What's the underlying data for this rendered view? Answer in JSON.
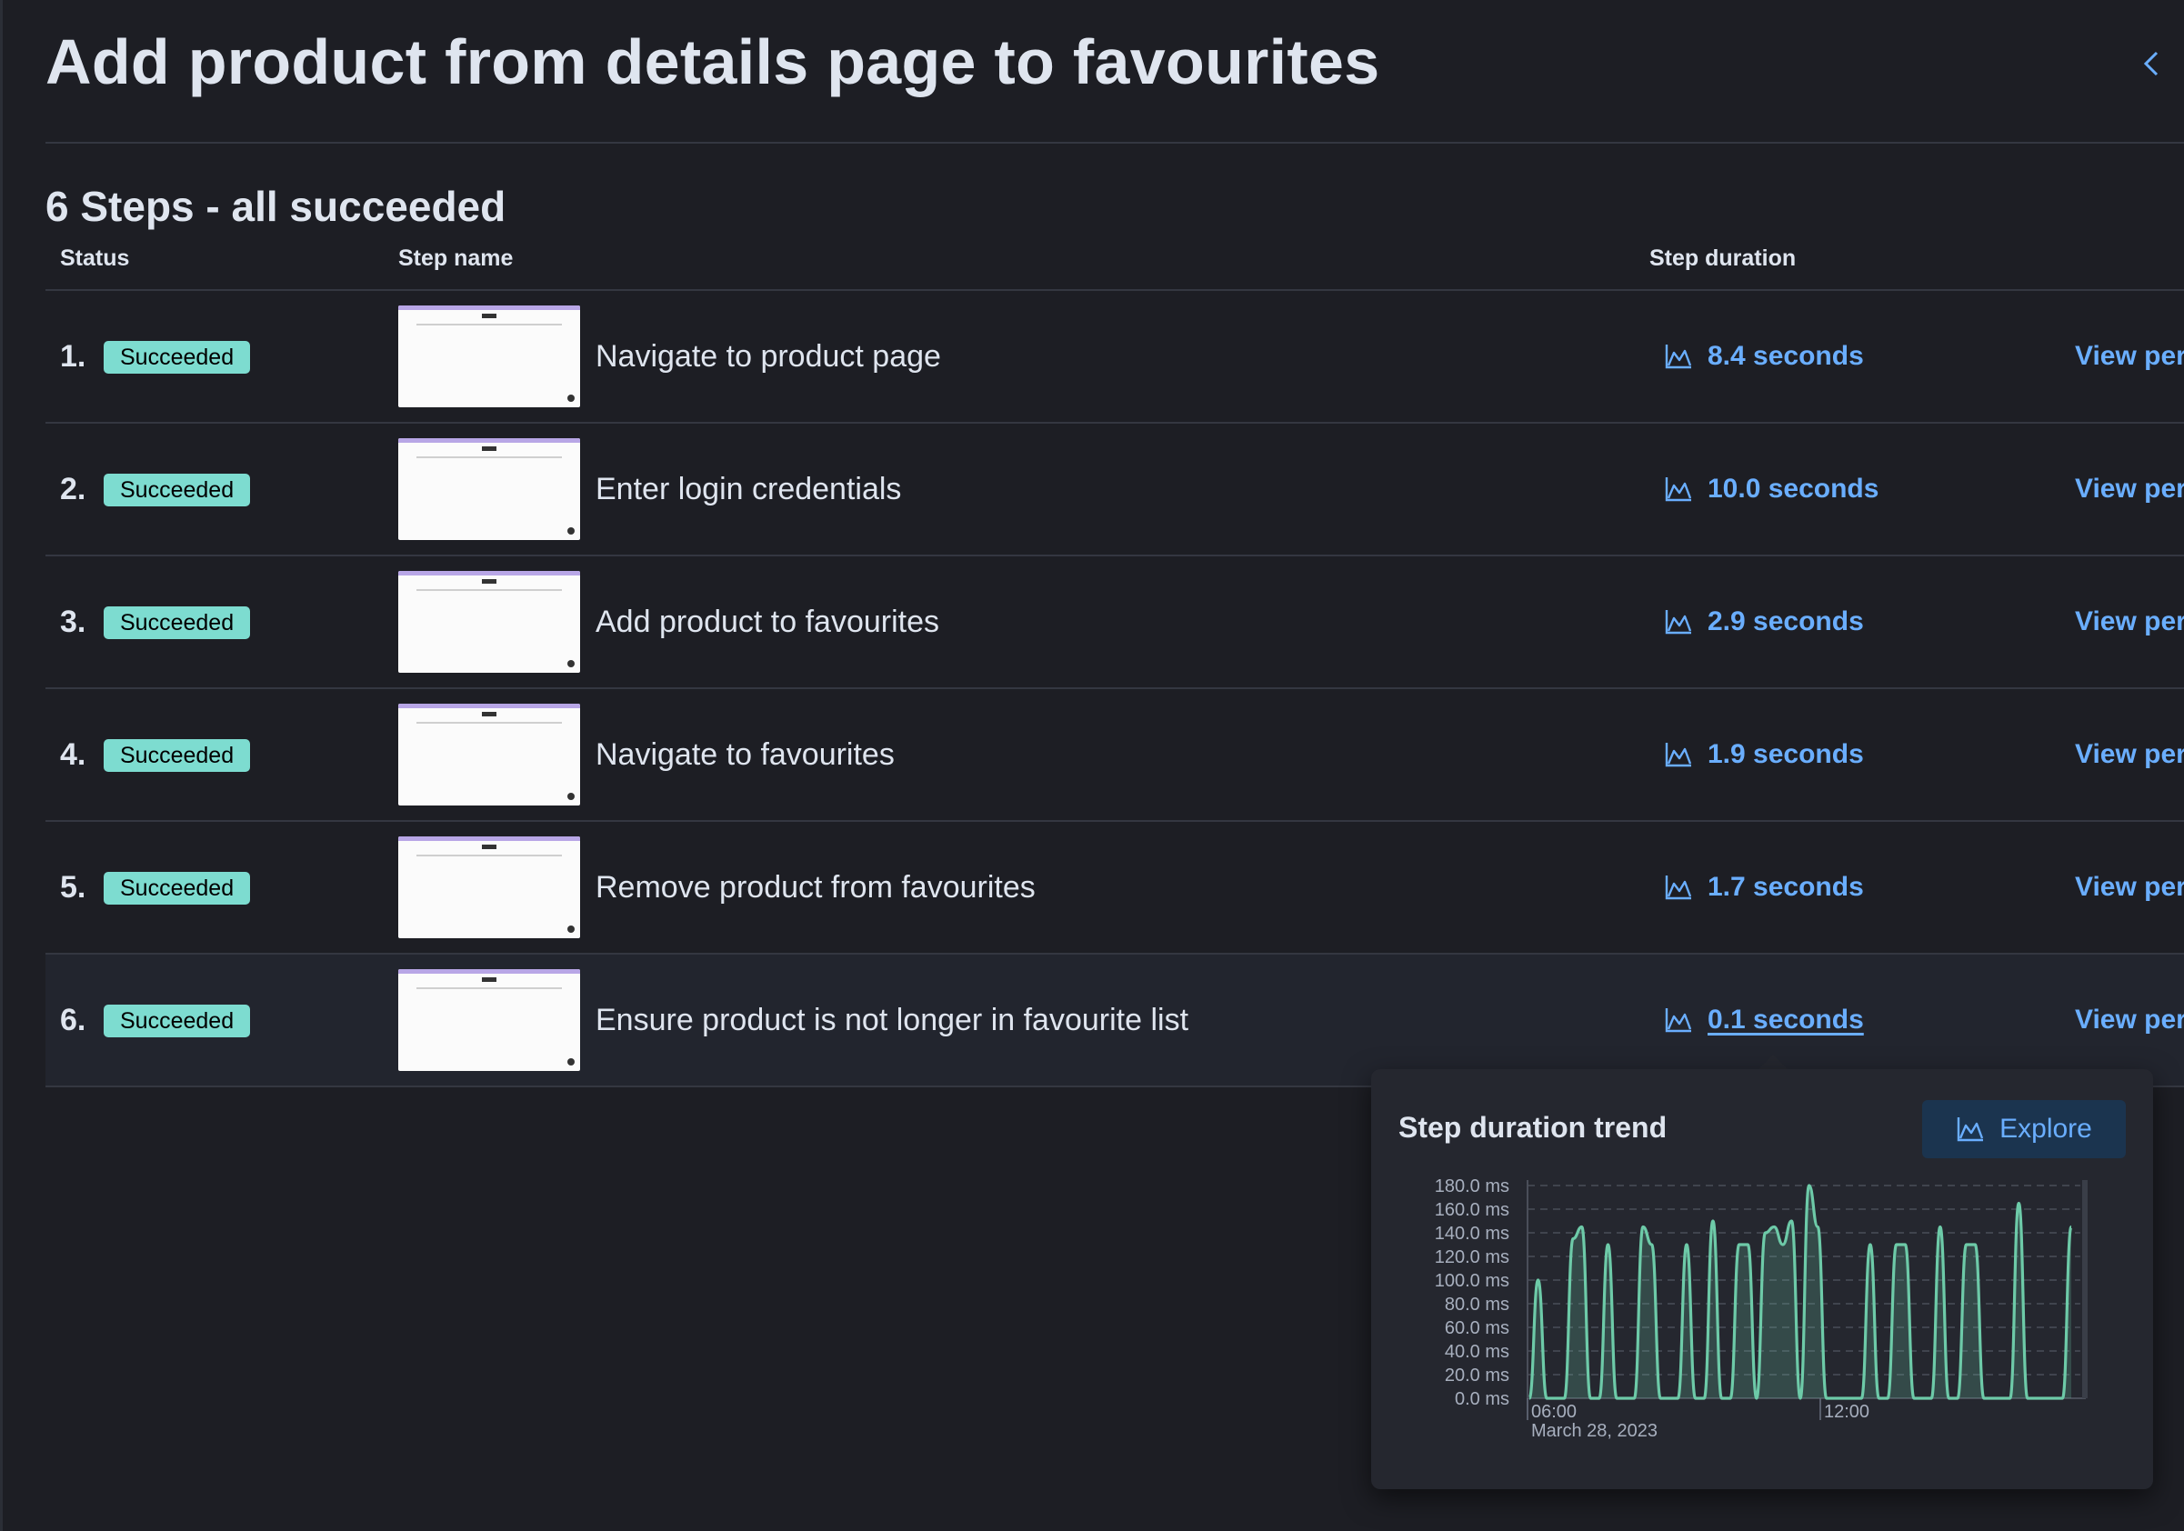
{
  "page": {
    "title": "Add product from details page to favourites",
    "summary": "6 Steps - all succeeded"
  },
  "table": {
    "headers": {
      "status": "Status",
      "step_name": "Step name",
      "step_duration": "Step duration"
    },
    "rows": [
      {
        "number": "1.",
        "status": "Succeeded",
        "name": "Navigate to product page",
        "duration": "8.4 seconds",
        "view": "View per"
      },
      {
        "number": "2.",
        "status": "Succeeded",
        "name": "Enter login credentials",
        "duration": "10.0 seconds",
        "view": "View per"
      },
      {
        "number": "3.",
        "status": "Succeeded",
        "name": "Add product to favourites",
        "duration": "2.9 seconds",
        "view": "View per"
      },
      {
        "number": "4.",
        "status": "Succeeded",
        "name": "Navigate to favourites",
        "duration": "1.9 seconds",
        "view": "View per"
      },
      {
        "number": "5.",
        "status": "Succeeded",
        "name": "Remove product from favourites",
        "duration": "1.7 seconds",
        "view": "View per"
      },
      {
        "number": "6.",
        "status": "Succeeded",
        "name": "Ensure product is not longer in favourite list",
        "duration": "0.1 seconds",
        "view": "View per"
      }
    ],
    "active_row": 5
  },
  "popover": {
    "title": "Step duration trend",
    "explore_label": "Explore"
  },
  "colors": {
    "background": "#1d1e24",
    "badge": "#7ddcd0",
    "link": "#6aaeff",
    "trend_line": "#6dcaa8"
  },
  "icons": {
    "collapse": "chevron-left-icon",
    "duration": "area-chart-icon",
    "explore": "area-chart-icon"
  },
  "chart_data": {
    "type": "area",
    "title": "Step duration trend",
    "y_unit": "ms",
    "ylim": [
      0,
      180
    ],
    "y_ticks": [
      "180.0 ms",
      "160.0 ms",
      "140.0 ms",
      "120.0 ms",
      "100.0 ms",
      "80.0 ms",
      "60.0 ms",
      "40.0 ms",
      "20.0 ms",
      "0.0 ms"
    ],
    "x_ticks": [
      "06:00",
      "12:00"
    ],
    "x_subtitle": "March 28, 2023",
    "grid": true,
    "series": [
      {
        "values": [
          0,
          100,
          0,
          0,
          0,
          135,
          145,
          0,
          0,
          130,
          0,
          0,
          0,
          145,
          130,
          0,
          0,
          0,
          130,
          0,
          0,
          150,
          0,
          0,
          130,
          130,
          0,
          140,
          145,
          130,
          150,
          0,
          180,
          145,
          0,
          0,
          0,
          0,
          0,
          130,
          0,
          0,
          130,
          130,
          0,
          0,
          0,
          145,
          0,
          0,
          130,
          130,
          0,
          0,
          0,
          0,
          165,
          0,
          0,
          0,
          0,
          0,
          145
        ]
      }
    ]
  }
}
